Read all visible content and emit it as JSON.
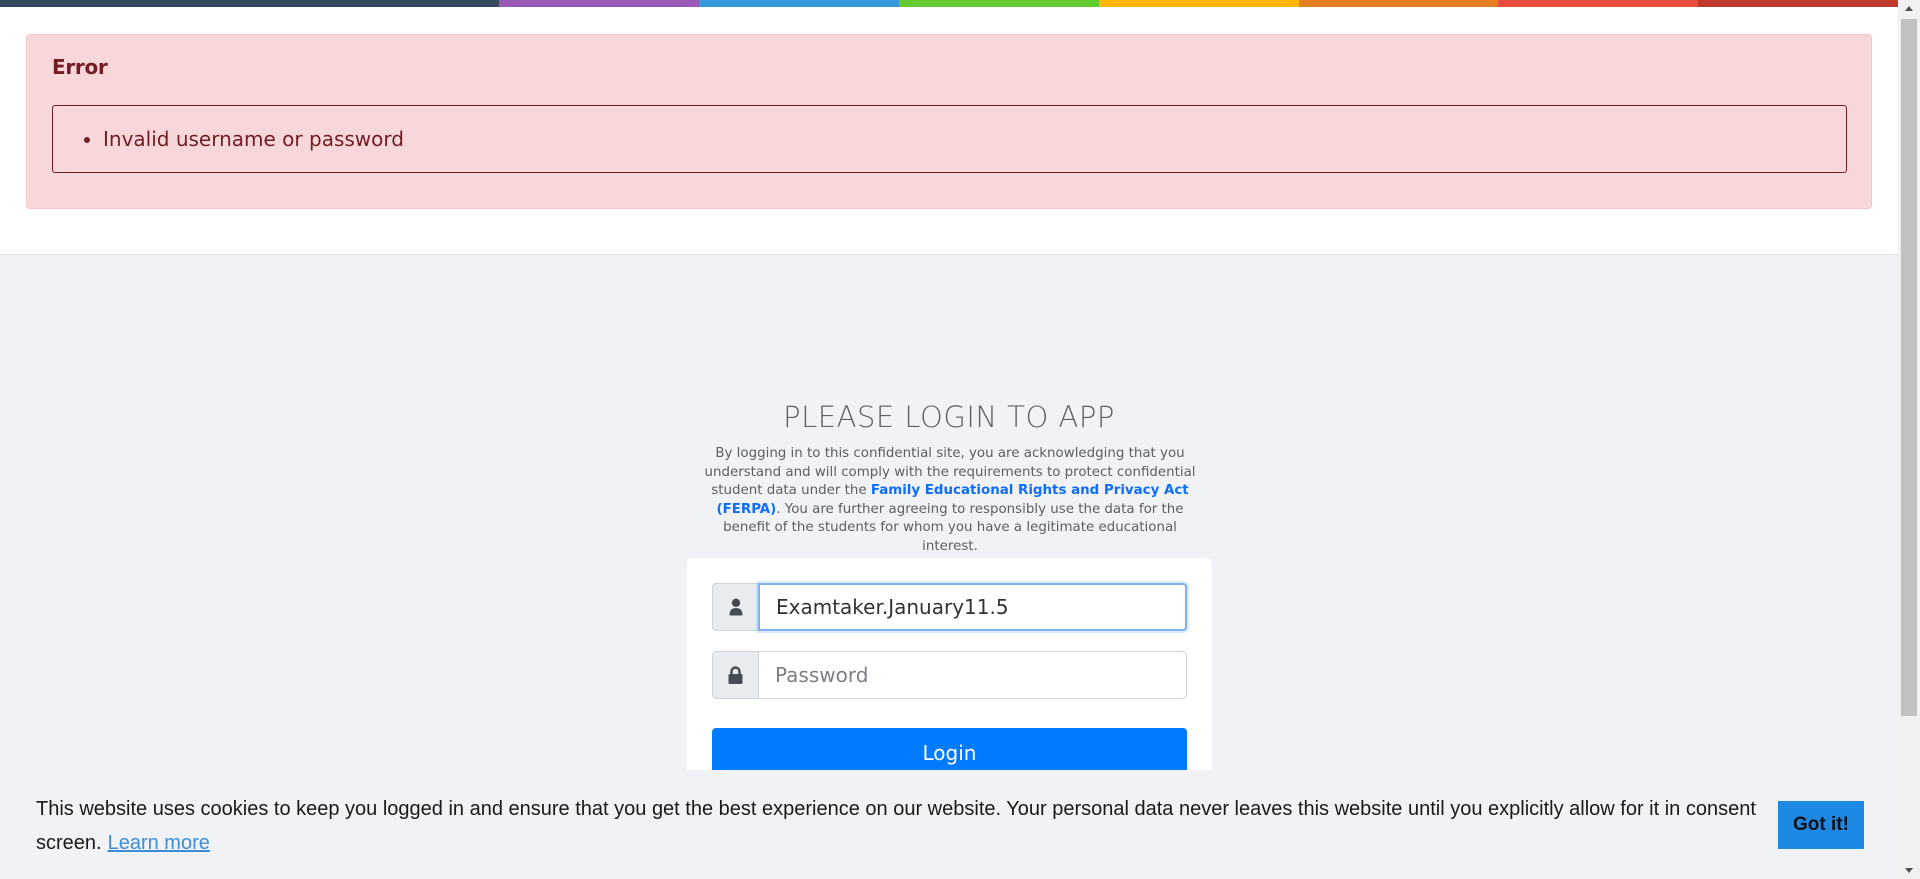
{
  "colors": {
    "rainbow": [
      "#34495e",
      "#9b59b6",
      "#3498db",
      "#62cb31",
      "#ffb606",
      "#e67e22",
      "#e74c3c",
      "#c0392b"
    ],
    "primary": "#007bff",
    "error_bg": "#f8d7da",
    "error_text": "#721c24"
  },
  "error": {
    "title": "Error",
    "messages": [
      "Invalid username or password"
    ]
  },
  "login": {
    "title": "PLEASE LOGIN TO APP",
    "desc_before": "By logging in to this confidential site, you are acknowledging that you understand and will comply with the requirements to protect confidential student data under the ",
    "ferpa_link": "Family Educational Rights and Privacy Act (FERPA)",
    "desc_after": ". You are further agreeing to responsibly use the data for the benefit of the students for whom you have a legitimate educational interest.",
    "username_value": "Examtaker.January11.5",
    "username_icon": "user-icon",
    "password_placeholder": "Password",
    "password_icon": "lock-icon",
    "login_label": "Login"
  },
  "cookie": {
    "text": "This website uses cookies to keep you logged in and ensure that you get the best experience on our website. Your personal data never leaves this website until you explicitly allow for it in consent screen.",
    "learn_more": "Learn more",
    "got_it": "Got it!"
  }
}
